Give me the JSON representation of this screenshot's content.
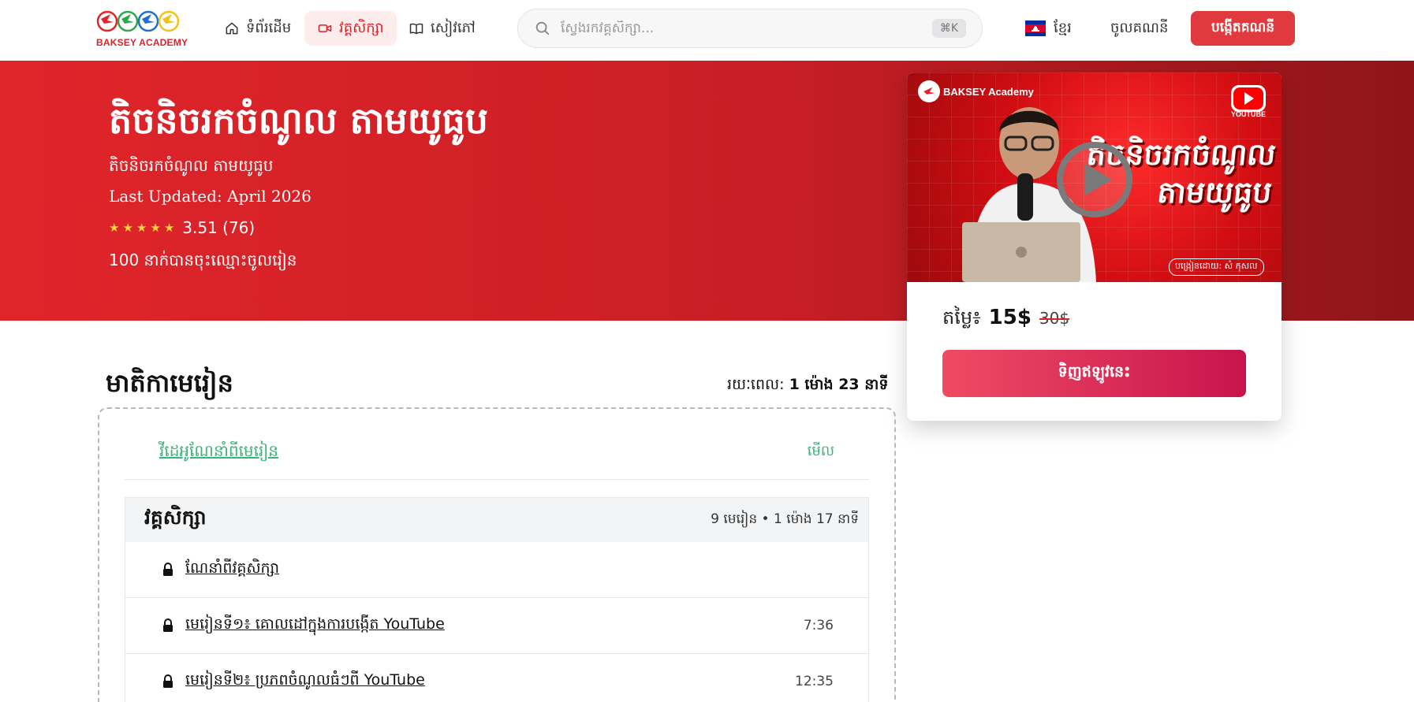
{
  "header": {
    "logo_text": "BAKSEY ACADEMY",
    "nav": [
      {
        "label": "ទំព័រដើម",
        "icon": "home-icon"
      },
      {
        "label": "វគ្គសិក្សា",
        "icon": "video-icon",
        "active": true
      },
      {
        "label": "សៀវភៅ",
        "icon": "book-icon"
      }
    ],
    "search": {
      "placeholder": "ស្វែងរកវគ្គសិក្សា...",
      "shortcut": "⌘K"
    },
    "language": "ខ្មែរ",
    "login_label": "ចូលគណនី",
    "signup_label": "បង្កើតគណនី"
  },
  "hero": {
    "title": "តិចនិចរកចំណូល តាមយូធូប",
    "subtitle": "តិចនិចរកចំណូល តាមយូធូប",
    "last_updated": "Last Updated: April 2026",
    "rating": {
      "stars": 5,
      "text": "3.51 (76)"
    },
    "enrolled": "100 នាក់បានចុះឈ្មោះចូលរៀន"
  },
  "card": {
    "thumbnail": {
      "brand": "BAKSEY Academy",
      "youtube_label": "YOUTUBE",
      "title_line1": "តិចនិចរកចំណូល",
      "title_line2": "តាមយូធូប",
      "instructor": "បង្រៀនដោយ: សំ កុសល"
    },
    "price_label": "តម្លៃ៖",
    "price_now": "15$",
    "price_old": "30$",
    "buy_label": "ទិញឥឡូវនេះ"
  },
  "toc": {
    "title": "មាតិកាមេរៀន",
    "duration_label": "រយៈពេល:",
    "duration_value": "1 ម៉ោង 23 នាទី",
    "preview": {
      "label": "វីដេអូណែនាំពីមេរៀន",
      "action": "មើល"
    },
    "section": {
      "title": "វគ្គសិក្សា",
      "meta": "9 មេរៀន • 1 ម៉ោង 17 នាទី",
      "lessons": [
        {
          "title": "ណែនាំពីវគ្គសិក្សា",
          "time": ""
        },
        {
          "title": "មេរៀនទី១៖ គោលដៅក្នុងការបង្កើត YouTube",
          "time": "7:36"
        },
        {
          "title": "មេរៀនទី២៖ ប្រភពចំណូលធំៗពី YouTube",
          "time": "12:35"
        }
      ]
    }
  },
  "colors": {
    "brand_red": "#d8232a",
    "accent_green": "#3bb37a",
    "buy_gradient_start": "#f04a64",
    "buy_gradient_end": "#c7154c"
  }
}
